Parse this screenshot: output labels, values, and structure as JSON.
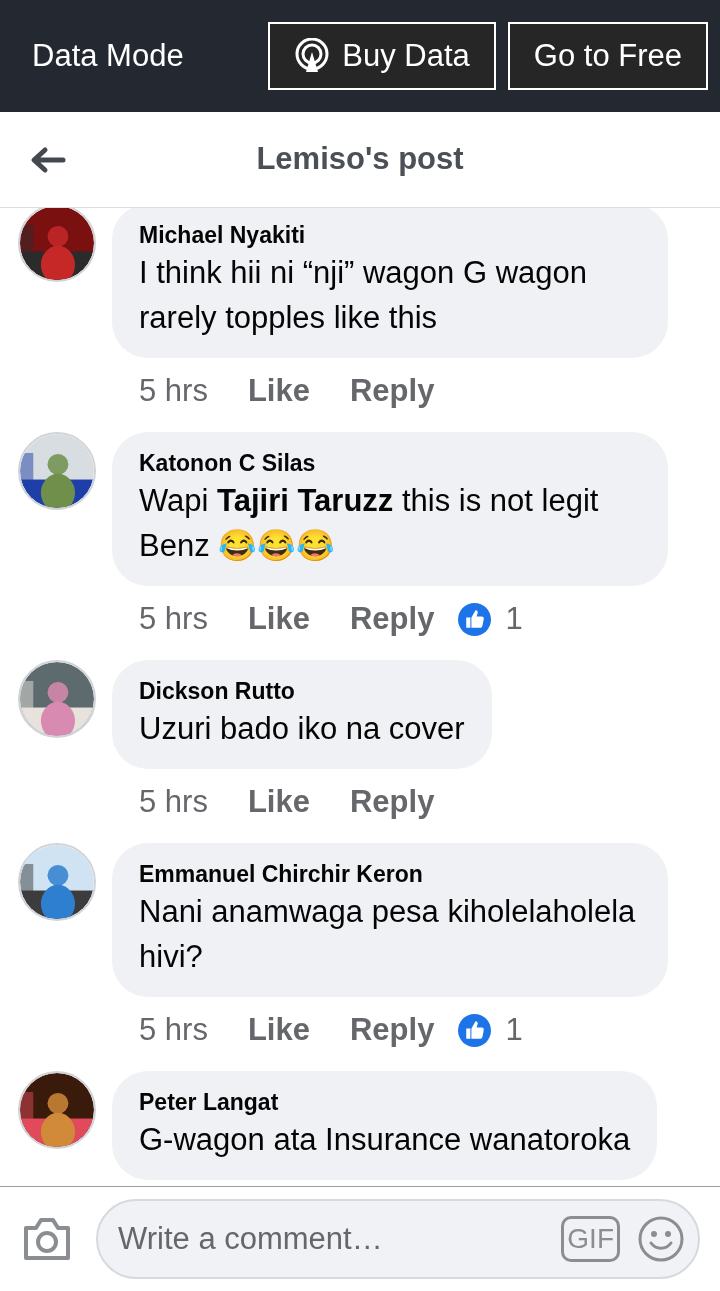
{
  "top_bar": {
    "title": "Data Mode",
    "buttons": [
      {
        "kind": "buy",
        "label": "Buy Data"
      },
      {
        "kind": "free",
        "label": "Go to Free"
      }
    ]
  },
  "nav": {
    "title": "Lemiso's post"
  },
  "comments": [
    {
      "author": "Michael Nyakiti",
      "text": "I think hii ni “nji” wagon G wagon rarely topples like this",
      "time": "5 hrs",
      "like": "Like",
      "reply": "Reply"
    },
    {
      "author": "Katonon C Silas",
      "text": "Wapi **Tajiri Taruzz** this is not legit Benz 😂😂😂",
      "time": "5 hrs",
      "like": "Like",
      "reply": "Reply",
      "likes": "1"
    },
    {
      "author": "Dickson Rutto",
      "text": "Uzuri bado iko na cover",
      "time": "5 hrs",
      "like": "Like",
      "reply": "Reply"
    },
    {
      "author": "Emmanuel Chirchir Keron",
      "text": "Nani anamwaga pesa kiholelaholela hivi?",
      "time": "5 hrs",
      "like": "Like",
      "reply": "Reply",
      "likes": "1"
    },
    {
      "author": "Peter Langat",
      "text": "G-wagon ata Insurance wanatoroka"
    }
  ],
  "composer": {
    "placeholder": "Write a comment…",
    "gif": "GIF"
  }
}
